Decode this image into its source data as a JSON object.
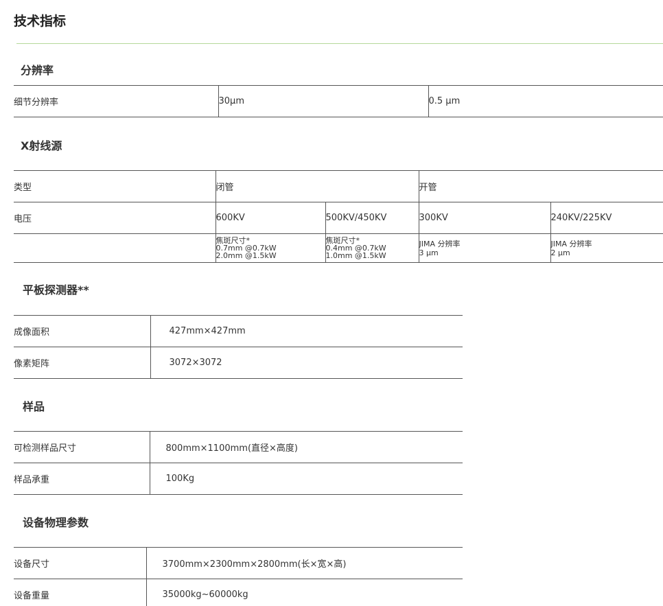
{
  "page_title": "技术指标",
  "resolution": {
    "title": "分辨率",
    "row": {
      "label": "细节分辨率",
      "value1": "30μm",
      "value2": "0.5 μm"
    }
  },
  "xray": {
    "title": "X射线源",
    "type_row": {
      "label": "类型",
      "closed": "闭管",
      "open": "开管"
    },
    "voltage_row": {
      "label": "电压",
      "v1": "600KV",
      "v2": "500KV/450KV",
      "v3": "300KV",
      "v4": "240KV/225KV"
    },
    "detail_row": {
      "c1": [
        "焦斑尺寸*",
        "0.7mm @0.7kW",
        "2.0mm @1.5kW"
      ],
      "c2": [
        "焦斑尺寸*",
        "0.4mm @0.7kW",
        "1.0mm @1.5kW"
      ],
      "c3": [
        "JIMA 分辨率",
        "3 μm"
      ],
      "c4": [
        "JIMA 分辨率",
        "2 μm"
      ]
    }
  },
  "detector": {
    "title": "平板探测器**",
    "rows": [
      {
        "label": "成像面积",
        "value": "427mm×427mm"
      },
      {
        "label": "像素矩阵",
        "value": "3072×3072"
      }
    ]
  },
  "sample": {
    "title": "样品",
    "rows": [
      {
        "label": "可检测样品尺寸",
        "value": "800mm×1100mm(直径×高度)"
      },
      {
        "label": "样品承重",
        "value": "100Kg"
      }
    ]
  },
  "equipment": {
    "title": "设备物理参数",
    "rows": [
      {
        "label": "设备尺寸",
        "value": "3700mm×2300mm×2800mm(长×宽×高)"
      },
      {
        "label": "设备重量",
        "value": "35000kg~60000kg"
      }
    ]
  }
}
